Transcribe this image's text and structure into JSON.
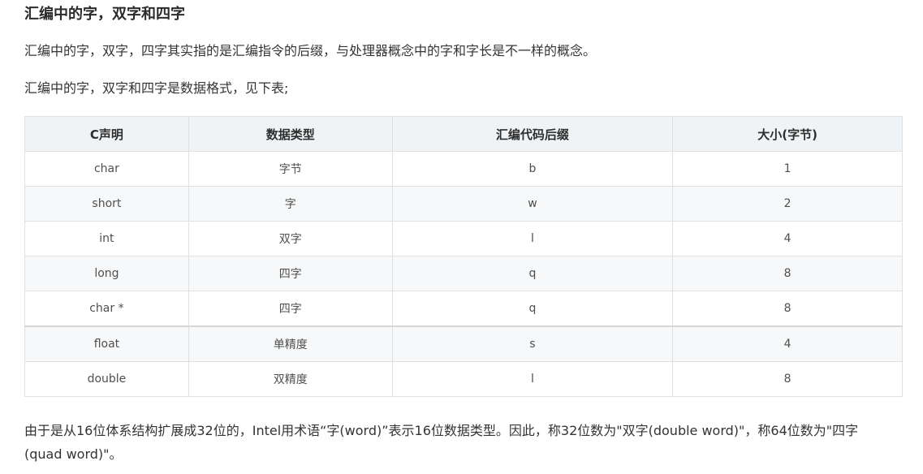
{
  "heading": "汇编中的字，双字和四字",
  "paragraph1": "汇编中的字，双字，四字其实指的是汇编指令的后缀，与处理器概念中的字和字长是不一样的概念。",
  "paragraph2": "汇编中的字，双字和四字是数据格式，见下表;",
  "table": {
    "headers": [
      "C声明",
      "数据类型",
      "汇编代码后缀",
      "大小(字节)"
    ],
    "rows": [
      [
        "char",
        "字节",
        "b",
        "1"
      ],
      [
        "short",
        "字",
        "w",
        "2"
      ],
      [
        "int",
        "双字",
        "l",
        "4"
      ],
      [
        "long",
        "四字",
        "q",
        "8"
      ],
      [
        "char *",
        "四字",
        "q",
        "8"
      ],
      [
        "float",
        "单精度",
        "s",
        "4"
      ],
      [
        "double",
        "双精度",
        "l",
        "8"
      ]
    ]
  },
  "paragraph3": "由于是从16位体系结构扩展成32位的，Intel用术语“字(word)”表示16位数据类型。因此，称32位数为\"双字(double word)\"，称64位数为\"四字(quad word)\"。"
}
